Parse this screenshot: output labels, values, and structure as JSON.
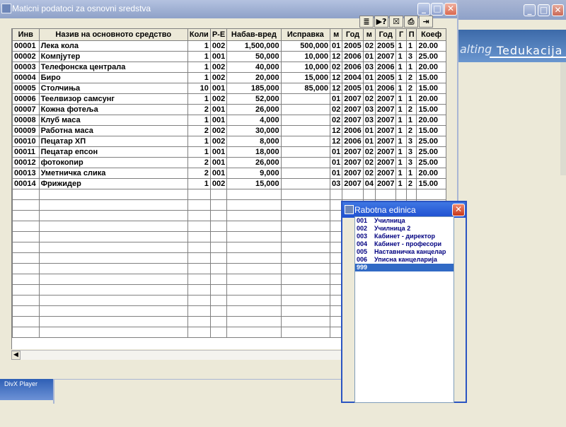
{
  "main_window": {
    "title": "Maticni podatoci za osnovni sredstva"
  },
  "toolbar": {
    "buttons": [
      "≣",
      "▶?",
      "☒",
      "⎙",
      "⇥"
    ]
  },
  "table": {
    "headers": [
      "Инв",
      "Назив на основното средство",
      "Коли",
      "Р-Е",
      "Набав-вред",
      "Исправка",
      "м",
      "Год",
      "м",
      "Год",
      "Г",
      "П",
      "Коеф"
    ],
    "rows": [
      [
        "00001",
        "Лека кола",
        "1",
        "002",
        "1,500,000",
        "500,000",
        "01",
        "2005",
        "02",
        "2005",
        "1",
        "1",
        "20.00"
      ],
      [
        "00002",
        "Компјутер",
        "1",
        "001",
        "50,000",
        "10,000",
        "12",
        "2006",
        "01",
        "2007",
        "1",
        "3",
        "25.00"
      ],
      [
        "00003",
        "Телефонска централа",
        "1",
        "002",
        "40,000",
        "10,000",
        "02",
        "2006",
        "03",
        "2006",
        "1",
        "1",
        "20.00"
      ],
      [
        "00004",
        "Биро",
        "1",
        "002",
        "20,000",
        "15,000",
        "12",
        "2004",
        "01",
        "2005",
        "1",
        "2",
        "15.00"
      ],
      [
        "00005",
        "Столчиња",
        "10",
        "001",
        "185,000",
        "85,000",
        "12",
        "2005",
        "01",
        "2006",
        "1",
        "2",
        "15.00"
      ],
      [
        "00006",
        "Теелвизор самсунг",
        "1",
        "002",
        "52,000",
        "",
        "01",
        "2007",
        "02",
        "2007",
        "1",
        "1",
        "20.00"
      ],
      [
        "00007",
        "Кожна фотеља",
        "2",
        "001",
        "26,000",
        "",
        "02",
        "2007",
        "03",
        "2007",
        "1",
        "2",
        "15.00"
      ],
      [
        "00008",
        "Клуб  маса",
        "1",
        "001",
        "4,000",
        "",
        "02",
        "2007",
        "03",
        "2007",
        "1",
        "1",
        "20.00"
      ],
      [
        "00009",
        "Работна маса",
        "2",
        "002",
        "30,000",
        "",
        "12",
        "2006",
        "01",
        "2007",
        "1",
        "2",
        "15.00"
      ],
      [
        "00010",
        "Пецатар ХП",
        "1",
        "002",
        "8,000",
        "",
        "12",
        "2006",
        "01",
        "2007",
        "1",
        "3",
        "25.00"
      ],
      [
        "00011",
        "Пецатар епсон",
        "1",
        "001",
        "18,000",
        "",
        "01",
        "2007",
        "02",
        "2007",
        "1",
        "3",
        "25.00"
      ],
      [
        "00012",
        "фотокопир",
        "2",
        "001",
        "26,000",
        "",
        "01",
        "2007",
        "02",
        "2007",
        "1",
        "3",
        "25.00"
      ],
      [
        "00013",
        "Уметничка слика",
        "2",
        "001",
        "9,000",
        "",
        "01",
        "2007",
        "02",
        "2007",
        "1",
        "1",
        "20.00"
      ],
      [
        "00014",
        "Фрижидер",
        "1",
        "002",
        "15,000",
        "",
        "03",
        "2007",
        "04",
        "2007",
        "1",
        "2",
        "15.00"
      ]
    ]
  },
  "popup": {
    "title": "Rabotna edinica",
    "items": [
      {
        "code": "001",
        "name": "Училница"
      },
      {
        "code": "002",
        "name": "Училница 2"
      },
      {
        "code": "003",
        "name": "Кабинет - директор"
      },
      {
        "code": "004",
        "name": "Кабинет - професори"
      },
      {
        "code": "005",
        "name": "Наставничка канцелар"
      },
      {
        "code": "006",
        "name": "Уписна канцеларија"
      },
      {
        "code": "999",
        "name": ""
      }
    ],
    "selected_index": 6
  },
  "background": {
    "logo_text1": "alting",
    "logo_text2": "Tedukacija"
  },
  "taskbar": {
    "item_label": "DivX Player"
  }
}
